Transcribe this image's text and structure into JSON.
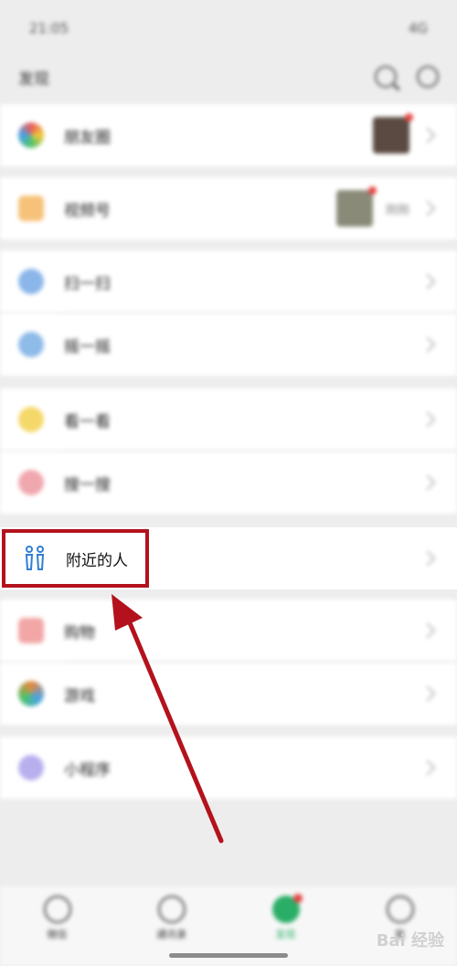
{
  "status": {
    "time": "21:05",
    "right": "4G"
  },
  "header": {
    "title": "发现"
  },
  "rows": [
    {
      "label": "朋友圈",
      "icon": "moments-icon",
      "color": "#4aa2e8"
    },
    {
      "label": "视频号",
      "icon": "channels-icon",
      "color": "#f3a54a",
      "tag": "刚刚"
    },
    {
      "label": "扫一扫",
      "icon": "scan-icon",
      "color": "#5b8fd9"
    },
    {
      "label": "摇一摇",
      "icon": "shake-icon",
      "color": "#5b9ce0"
    },
    {
      "label": "看一看",
      "icon": "top-stories-icon",
      "color": "#f3c93a"
    },
    {
      "label": "搜一搜",
      "icon": "search-feature-icon",
      "color": "#e8707a"
    },
    {
      "label": "购物",
      "icon": "shopping-icon",
      "color": "#e46b6b"
    },
    {
      "label": "游戏",
      "icon": "games-icon",
      "color": "#e8883a"
    },
    {
      "label": "小程序",
      "icon": "mini-programs-icon",
      "color": "#8b7fe0"
    }
  ],
  "nearby": {
    "label": "附近的人",
    "icon_color": "#2f7fd1"
  },
  "tabs": [
    {
      "label": "微信"
    },
    {
      "label": "通讯录"
    },
    {
      "label": "发现",
      "active": true
    },
    {
      "label": "我"
    }
  ],
  "watermark": "Bai 经验",
  "colors": {
    "highlight": "#b3121c",
    "accent": "#2aae67",
    "badge": "#e64340"
  }
}
